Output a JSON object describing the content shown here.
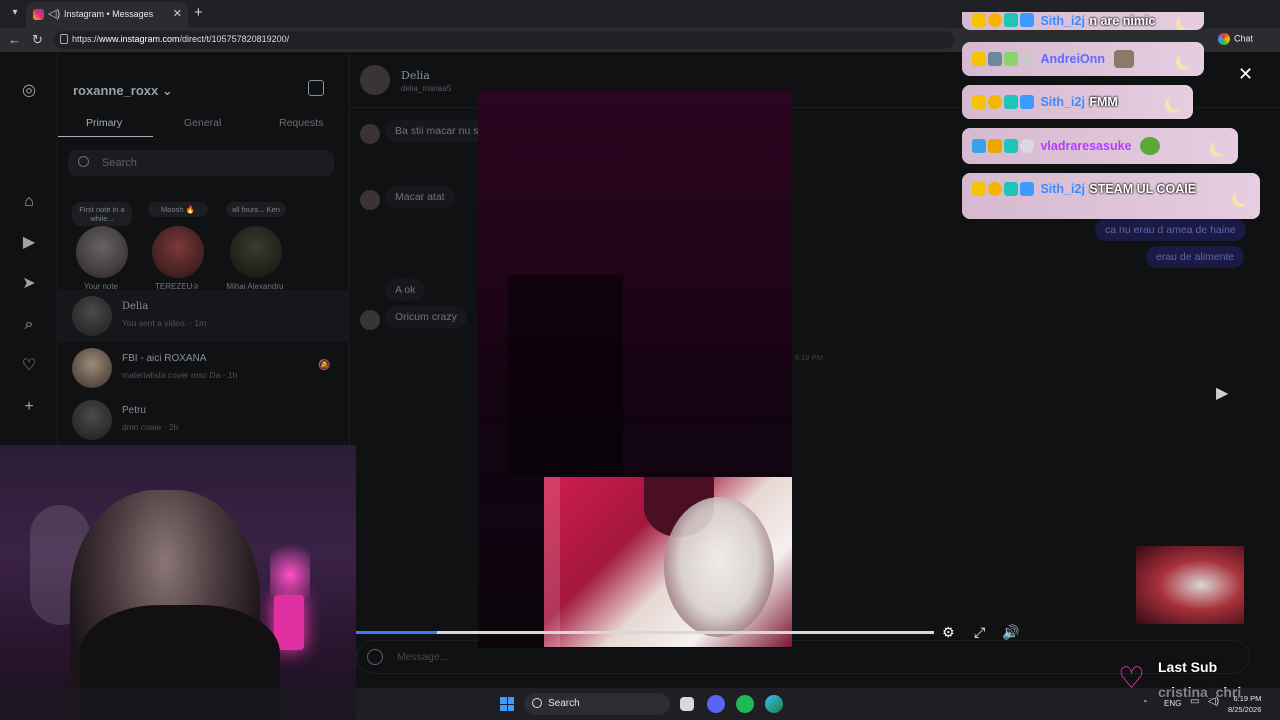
{
  "browser": {
    "tab_title": "Instagram • Messages",
    "url_prefix": "https://",
    "url_domain": "www.instagram.com",
    "url_path": "/direct/t/105757820819200/",
    "chat_label": "Chat"
  },
  "instagram": {
    "username": "roxanne_roxx",
    "tabs": [
      "Primary",
      "General",
      "Requests"
    ],
    "search_placeholder": "Search",
    "notes": [
      {
        "bubble": "First note in a while...",
        "name": "Your note"
      },
      {
        "bubble": "Moosh 🔥",
        "name": "TEREZEU✰"
      },
      {
        "bubble": "all fours... Ken",
        "name": "Mihai Alexandru"
      }
    ],
    "conversations": [
      {
        "name": "Delia",
        "sub": "You sent a video. · 1m"
      },
      {
        "name": "FBI - aici ROXANA",
        "sub": "materialista cover rosc Da · 1h"
      },
      {
        "name": "Petru",
        "sub": "dmn coaie · 2h"
      }
    ],
    "thread": {
      "name": "Delia",
      "handle": "delia_manaa5",
      "messages_in": [
        "Ba stii macar nu s",
        "Macar atat",
        "A ok",
        "Oricum crazy"
      ],
      "messages_out": [
        "ca nu erau d amea de haine",
        "erau de alimente"
      ],
      "timestamp": "6:19 PM",
      "composer_placeholder": "Message..."
    }
  },
  "video": {
    "progress_percent": 14
  },
  "stream_chat": [
    {
      "user": "Sith_i2j",
      "text": "n are nimic",
      "user_color": "#3a8bff"
    },
    {
      "user": "AndreiOnn",
      "text": "",
      "user_color": "#5a6cff"
    },
    {
      "user": "Sith_i2j",
      "text": "FMM",
      "user_color": "#3a8bff"
    },
    {
      "user": "vladraresasuke",
      "text": "",
      "user_color": "#b23cff"
    },
    {
      "user": "Sith_i2j",
      "text": "STEAM UL COAIE",
      "user_color": "#3a8bff"
    }
  ],
  "last_sub": {
    "title": "Last Sub",
    "name": "cristina_chri"
  },
  "taskbar": {
    "search_label": "Search",
    "lang": "ENG",
    "time": "6:19 PM",
    "date": "8/25/2026"
  }
}
